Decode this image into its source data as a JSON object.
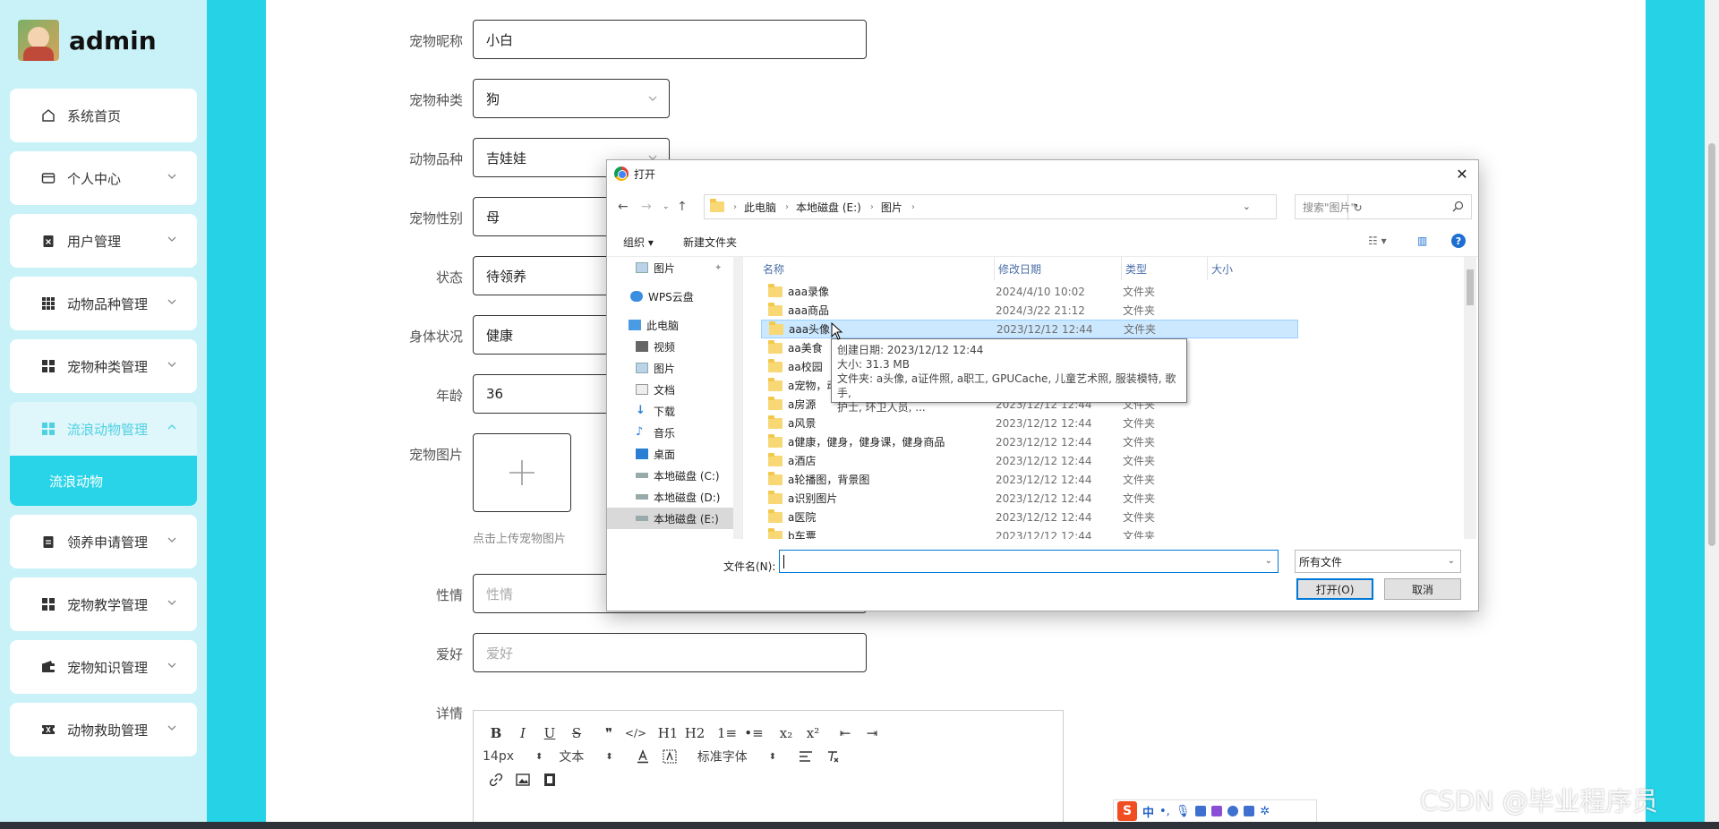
{
  "sidebar": {
    "username": "admin",
    "menu": [
      {
        "label": "系统首页",
        "icon": "home-icon",
        "expandable": false
      },
      {
        "label": "个人中心",
        "icon": "card-icon",
        "expandable": true
      },
      {
        "label": "用户管理",
        "icon": "clipboard-x-icon",
        "expandable": true
      },
      {
        "label": "动物品种管理",
        "icon": "grid-9-icon",
        "expandable": true
      },
      {
        "label": "宠物种类管理",
        "icon": "grid-4-icon",
        "expandable": true
      },
      {
        "label": "流浪动物管理",
        "icon": "grid-4-icon",
        "expandable": true,
        "active": true
      },
      {
        "label": "领养申请管理",
        "icon": "clipboard-icon",
        "expandable": true
      },
      {
        "label": "宠物教学管理",
        "icon": "grid-4-icon",
        "expandable": true
      },
      {
        "label": "宠物知识管理",
        "icon": "wallet-icon",
        "expandable": true
      },
      {
        "label": "动物救助管理",
        "icon": "ticket-icon",
        "expandable": true
      }
    ],
    "submenu_active": "流浪动物"
  },
  "form": {
    "nickname": {
      "label": "宠物昵称",
      "value": "小白"
    },
    "kind": {
      "label": "宠物种类",
      "value": "狗"
    },
    "breed": {
      "label": "动物品种",
      "value": "吉娃娃"
    },
    "gender": {
      "label": "宠物性别",
      "value": "母"
    },
    "status": {
      "label": "状态",
      "value": "待领养"
    },
    "health": {
      "label": "身体状况",
      "value": "健康"
    },
    "age": {
      "label": "年龄",
      "value": "36"
    },
    "image": {
      "label": "宠物图片",
      "hint": "点击上传宠物图片"
    },
    "temperament": {
      "label": "性情",
      "placeholder": "性情"
    },
    "hobby": {
      "label": "爱好",
      "placeholder": "爱好"
    },
    "details": {
      "label": "详情"
    }
  },
  "editor": {
    "row1": [
      "B",
      "I",
      "U",
      "S",
      "❞",
      "</>",
      "H1",
      "H2",
      "1≡",
      "•≡",
      "x₂",
      "x²",
      "⇤",
      "⇥"
    ],
    "font_size": "14px",
    "text_type": "文本",
    "font_family": "标准字体"
  },
  "dialog": {
    "title": "打开",
    "breadcrumb": [
      "此电脑",
      "本地磁盘 (E:)",
      "图片"
    ],
    "search_placeholder": "搜索\"图片\"",
    "organize": "组织 ▾",
    "new_folder": "新建文件夹",
    "tree": [
      {
        "label": "图片",
        "icon": "picture-icon",
        "pinned": true
      },
      {
        "label": "WPS云盘",
        "icon": "cloud-icon"
      },
      {
        "label": "此电脑",
        "icon": "computer-icon"
      },
      {
        "label": "视频",
        "icon": "video-icon"
      },
      {
        "label": "图片",
        "icon": "picture-icon"
      },
      {
        "label": "文档",
        "icon": "document-icon"
      },
      {
        "label": "下载",
        "icon": "download-icon"
      },
      {
        "label": "音乐",
        "icon": "music-icon"
      },
      {
        "label": "桌面",
        "icon": "desktop-icon"
      },
      {
        "label": "本地磁盘 (C:)",
        "icon": "drive-icon"
      },
      {
        "label": "本地磁盘 (D:)",
        "icon": "drive-icon"
      },
      {
        "label": "本地磁盘 (E:)",
        "icon": "drive-icon",
        "selected": true
      }
    ],
    "columns": {
      "name": "名称",
      "date": "修改日期",
      "type": "类型",
      "size": "大小"
    },
    "files": [
      {
        "name": "aaa录像",
        "date": "2024/4/10 10:02",
        "type": "文件夹"
      },
      {
        "name": "aaa商品",
        "date": "2024/3/22 21:12",
        "type": "文件夹"
      },
      {
        "name": "aaa头像",
        "date": "2023/12/12 12:44",
        "type": "文件夹",
        "selected": true
      },
      {
        "name": "aa美食",
        "date": "",
        "type": ""
      },
      {
        "name": "aa校园",
        "date": "",
        "type": ""
      },
      {
        "name": "a宠物，动",
        "date": "",
        "type": ""
      },
      {
        "name": "a房源",
        "date": "2023/12/12 12:44",
        "type": "文件夹"
      },
      {
        "name": "a风景",
        "date": "2023/12/12 12:44",
        "type": "文件夹"
      },
      {
        "name": "a健康，健身，健身课，健身商品",
        "date": "2023/12/12 12:44",
        "type": "文件夹"
      },
      {
        "name": "a酒店",
        "date": "2023/12/12 12:44",
        "type": "文件夹"
      },
      {
        "name": "a轮播图，背景图",
        "date": "2023/12/12 12:44",
        "type": "文件夹"
      },
      {
        "name": "a识别图片",
        "date": "2023/12/12 12:44",
        "type": "文件夹"
      },
      {
        "name": "a医院",
        "date": "2023/12/12 12:44",
        "type": "文件夹"
      },
      {
        "name": "b车票",
        "date": "2023/12/12 12:44",
        "type": "文件夹"
      }
    ],
    "tooltip": {
      "line1": "创建日期: 2023/12/12 12:44",
      "line2": "大小: 31.3 MB",
      "line3": "文件夹: a头像, a证件照, a职工, GPUCache, 儿童艺术照, 服装模特, 歌手,",
      "line4": "护士, 环卫人员, ..."
    },
    "filename_label": "文件名(N):",
    "filename_value": "",
    "filetype": "所有文件",
    "open_button": "打开(O)",
    "cancel_button": "取消"
  },
  "ime": {
    "lang": "中",
    "logo": "S"
  },
  "watermark": "CSDN @毕业程序员",
  "colors": {
    "accent": "#25d2e6",
    "sidebar_bg": "#c9f2f8",
    "dialog_selection": "#cce8ff"
  }
}
